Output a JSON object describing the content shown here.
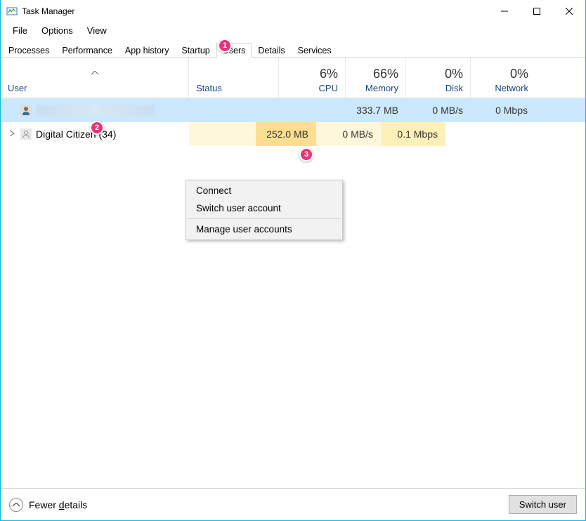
{
  "window": {
    "title": "Task Manager"
  },
  "menu": {
    "file": "File",
    "options": "Options",
    "view": "View"
  },
  "tabs": {
    "processes": "Processes",
    "performance": "Performance",
    "app_history": "App history",
    "startup": "Startup",
    "users": "Users",
    "details": "Details",
    "services": "Services"
  },
  "columns": {
    "user": "User",
    "status": "Status",
    "cpu_pct": "6%",
    "cpu_label": "CPU",
    "mem_pct": "66%",
    "mem_label": "Memory",
    "disk_pct": "0%",
    "disk_label": "Disk",
    "net_pct": "0%",
    "net_label": "Network"
  },
  "rows": [
    {
      "name": "",
      "status": "",
      "cpu": "",
      "memory": "333.7 MB",
      "disk": "0 MB/s",
      "network": "0 Mbps"
    },
    {
      "name": "Digital Citizen (34)",
      "status": "",
      "cpu": "",
      "memory": "252.0 MB",
      "disk": "0 MB/s",
      "network": "0.1 Mbps"
    }
  ],
  "context_menu": {
    "connect": "Connect",
    "switch": "Switch user account",
    "manage": "Manage user accounts"
  },
  "bottom": {
    "fewer_pre": "Fewer ",
    "fewer_u": "d",
    "fewer_post": "etails",
    "switch_user": "Switch user"
  },
  "badges": {
    "b1": "1",
    "b2": "2",
    "b3": "3"
  }
}
